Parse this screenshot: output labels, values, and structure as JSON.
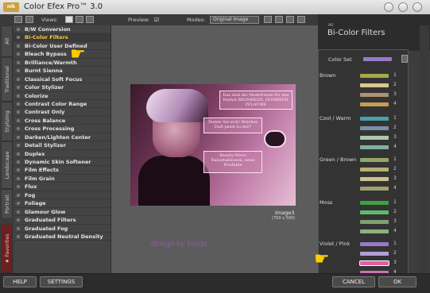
{
  "window": {
    "title": "Color Efex Pro™ 3.0",
    "logo": "nik"
  },
  "toolbar": {
    "views_label": "Views:",
    "preview_label": "Preview:",
    "preview_check": "☑",
    "modes_label": "Modes:",
    "modes_value": "Original Image"
  },
  "tabs": [
    "All",
    "Traditional",
    "Stylizing",
    "Landscape",
    "Portrait",
    "★ Favorites"
  ],
  "filters": [
    "B/W Conversion",
    "Bi-Color Filters",
    "Bi-Color User Defined",
    "Bleach Bypass",
    "Brilliance/Warmth",
    "Burnt Sienna",
    "Classical Soft Focus",
    "Color Stylizer",
    "Colorize",
    "Contrast Color Range",
    "Contrast Only",
    "Cross Balance",
    "Cross Processing",
    "Darken/Lighten Center",
    "Detail Stylizer",
    "Duplex",
    "Dynamic Skin Softener",
    "Film Effects",
    "Film Grain",
    "Flux",
    "Fog",
    "Foliage",
    "Glamour Glow",
    "Graduated Filters",
    "Graduated Fog",
    "Graduated Neutral Density"
  ],
  "selected_filter": "Bi-Color Filters",
  "preview": {
    "card1": "Das sind die Modefrends für den Herbst BROMBEER, HOMBEER, PFLAUME",
    "card2": "Testen Sie sich! Welcher Duft passt zu mir?",
    "card3": "Beauty-News Rabattaktionen, neue Produkte",
    "caption": "Image3",
    "caption2": "(700 x 500)",
    "watermark": "design by korda"
  },
  "right_panel": {
    "sub": "All",
    "title": "Bi-Color Filters",
    "color_set_label": "Color Set",
    "groups": [
      {
        "name": "Brown",
        "colors": [
          "#a8a84a",
          "#d8c890",
          "#b09070",
          "#c0a050"
        ]
      },
      {
        "name": "Cool / Warm",
        "colors": [
          "#4aa0a8",
          "#7890a8",
          "#a8c8b0",
          "#80b0a0"
        ]
      },
      {
        "name": "Green / Brown",
        "colors": [
          "#90a868",
          "#b8b070",
          "#d0c090",
          "#a0a070"
        ]
      },
      {
        "name": "Moss",
        "colors": [
          "#40a040",
          "#60b870",
          "#80a070",
          "#90b080"
        ]
      },
      {
        "name": "Violet / Pink",
        "colors": [
          "#9878c8",
          "#b0a0d0",
          "#e060a0",
          "#d070b0"
        ]
      }
    ],
    "numbers": [
      "1",
      "2",
      "3",
      "4"
    ],
    "selected_value": "3"
  },
  "buttons": {
    "help": "HELP",
    "settings": "SETTINGS",
    "cancel": "CANCEL",
    "ok": "OK"
  }
}
